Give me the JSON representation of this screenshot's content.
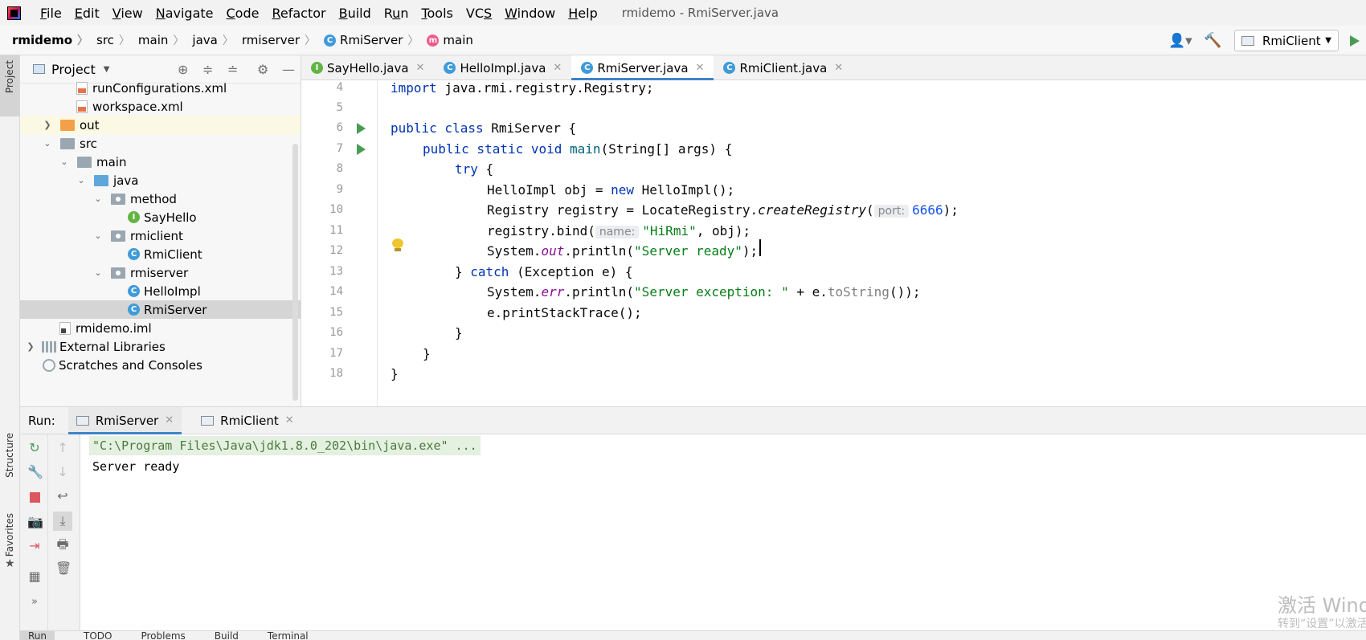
{
  "menubar": {
    "items": [
      "File",
      "Edit",
      "View",
      "Navigate",
      "Code",
      "Refactor",
      "Build",
      "Run",
      "Tools",
      "VCS",
      "Window",
      "Help"
    ],
    "underline": [
      "F",
      "E",
      "V",
      "N",
      "C",
      "R",
      "B",
      "u",
      "T",
      "S",
      "W",
      "H"
    ],
    "window_title": "rmidemo - RmiServer.java"
  },
  "navbar": {
    "crumbs": [
      "rmidemo",
      "src",
      "main",
      "java",
      "rmiserver",
      "RmiServer",
      "main"
    ],
    "run_config": "RmiClient"
  },
  "left_strip": {
    "project_label": "Project",
    "structure_label": "Structure",
    "favorites_label": "Favorites"
  },
  "project": {
    "title": "Project",
    "tree": [
      {
        "label": "runConfigurations.xml",
        "icon": "xml-file-icon"
      },
      {
        "label": "workspace.xml",
        "icon": "xml-file-icon"
      },
      {
        "label": "out",
        "icon": "folder-icon"
      },
      {
        "label": "src",
        "icon": "folder-icon"
      },
      {
        "label": "main",
        "icon": "folder-icon"
      },
      {
        "label": "java",
        "icon": "source-folder-icon"
      },
      {
        "label": "method",
        "icon": "package-icon"
      },
      {
        "label": "SayHello",
        "icon": "interface-icon"
      },
      {
        "label": "rmiclient",
        "icon": "package-icon"
      },
      {
        "label": "RmiClient",
        "icon": "class-icon"
      },
      {
        "label": "rmiserver",
        "icon": "package-icon"
      },
      {
        "label": "HelloImpl",
        "icon": "class-icon"
      },
      {
        "label": "RmiServer",
        "icon": "class-icon"
      },
      {
        "label": "rmidemo.iml",
        "icon": "iml-file-icon"
      },
      {
        "label": "External Libraries",
        "icon": "library-icon"
      },
      {
        "label": "Scratches and Consoles",
        "icon": "scratches-icon"
      }
    ],
    "selected": "RmiServer"
  },
  "editor": {
    "tabs": [
      "SayHello.java",
      "HelloImpl.java",
      "RmiServer.java",
      "RmiClient.java"
    ],
    "active_tab": "RmiServer.java",
    "line_numbers": [
      "4",
      "5",
      "6",
      "7",
      "8",
      "9",
      "10",
      "11",
      "12",
      "13",
      "14",
      "15",
      "16",
      "17",
      "18"
    ],
    "code": {
      "l4_kw": "import",
      "l4_rest": " java.rmi.registry.Registry;",
      "l6_kw": "public class",
      "l6_rest": " RmiServer {",
      "l7_kw": "public static void",
      "l7_m": " main",
      "l7_rest": "(String[] args) {",
      "l8_kw": "try",
      "l8_rest": " {",
      "l9_a": "HelloImpl obj = ",
      "l9_kw": "new",
      "l9_b": " HelloImpl();",
      "l10_a": "Registry registry = LocateRegistry.",
      "l10_m": "createRegistry",
      "l10_p": "(",
      "l10_hint": "port:",
      "l10_num": "6666",
      "l10_end": ");",
      "l11_a": "registry.bind(",
      "l11_hint": "name:",
      "l11_str": "\"HiRmi\"",
      "l11_end": ", obj);",
      "l12_a": "System.",
      "l12_f": "out",
      "l12_b": ".println(",
      "l12_str": "\"Server ready\"",
      "l12_end": ");",
      "l13_a": "} ",
      "l13_kw": "catch",
      "l13_b": " (Exception e) {",
      "l14_a": "System.",
      "l14_f": "err",
      "l14_b": ".println(",
      "l14_str": "\"Server exception: \"",
      "l14_c": " + e.",
      "l14_m": "toString",
      "l14_end": "());",
      "l15": "e.printStackTrace();",
      "l16": "}",
      "l17": "}",
      "l18": "}"
    }
  },
  "run_panel": {
    "label": "Run:",
    "tabs": [
      "RmiServer",
      "RmiClient"
    ],
    "active_tab": "RmiServer",
    "console": [
      "\"C:\\Program Files\\Java\\jdk1.8.0_202\\bin\\java.exe\" ...",
      "Server ready"
    ]
  },
  "status_bar": {
    "items": [
      "Run",
      "TODO",
      "Problems",
      "Build",
      "Terminal"
    ]
  },
  "watermark": {
    "line1": "激活 Windows",
    "line2": "转到“设置”以激活 Windows。"
  },
  "colors": {
    "accent": "#4083c9",
    "selection": "#a6d2ff",
    "keyword": "#0033b3",
    "string": "#067d17",
    "number": "#1750eb",
    "run_green": "#499c54"
  }
}
